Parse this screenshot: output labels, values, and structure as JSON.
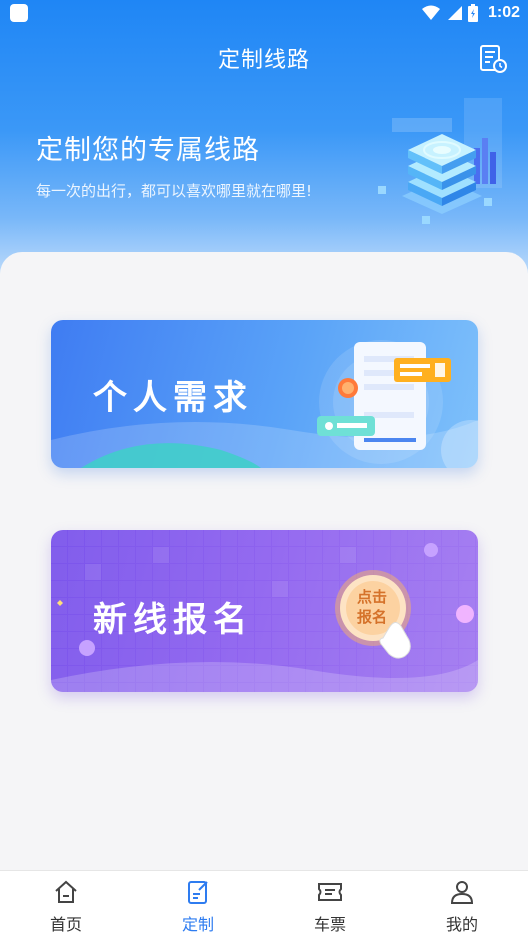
{
  "status_bar": {
    "time": "1:02"
  },
  "header": {
    "title": "定制线路",
    "hero_title": "定制您的专属线路",
    "hero_subtitle": "每一次的出行，都可以喜欢哪里就在哪里!"
  },
  "cards": [
    {
      "label": "个人需求"
    },
    {
      "label": "新线报名",
      "badge_line1": "点击",
      "badge_line2": "报名"
    }
  ],
  "tabs": [
    {
      "label": "首页",
      "icon": "home-icon",
      "active": false
    },
    {
      "label": "定制",
      "icon": "edit-doc-icon",
      "active": true
    },
    {
      "label": "车票",
      "icon": "ticket-icon",
      "active": false
    },
    {
      "label": "我的",
      "icon": "user-icon",
      "active": false
    }
  ],
  "colors": {
    "header_blue": "#1f86f5",
    "card_blue": "#3f7cf2",
    "card_purple": "#7a54eb",
    "tab_active": "#2e7cf0"
  }
}
